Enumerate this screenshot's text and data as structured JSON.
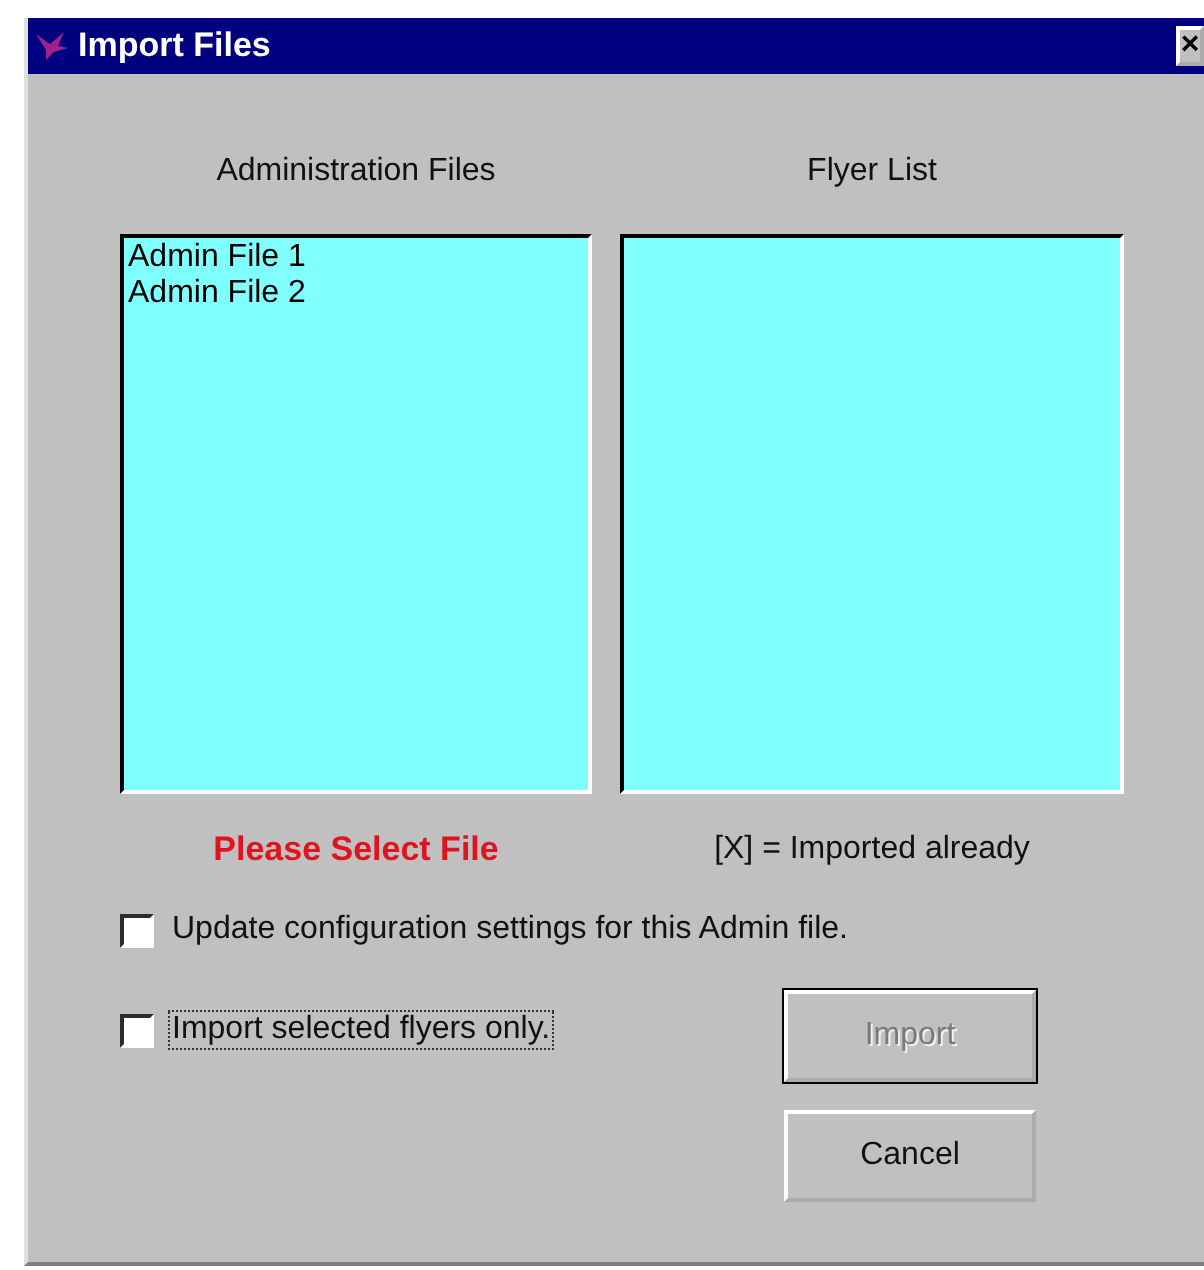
{
  "window": {
    "title": "Import Files",
    "close": "×"
  },
  "lists": [
    {
      "heading": "Administration Files",
      "items": [
        "Admin File 1",
        "Admin File 2"
      ]
    },
    {
      "heading": "Flyer List"
    }
  ],
  "status": "Please Select File",
  "legend": "[X] = Imported already",
  "options": [
    {
      "label": "Update configuration settings for this Admin file.",
      "checked": false,
      "focused": false
    },
    {
      "label": "Import selected flyers only.",
      "checked": false,
      "focused": true
    }
  ],
  "buttons": [
    {
      "label": "Import",
      "disabled": true
    },
    {
      "label": "Cancel",
      "disabled": false
    }
  ]
}
